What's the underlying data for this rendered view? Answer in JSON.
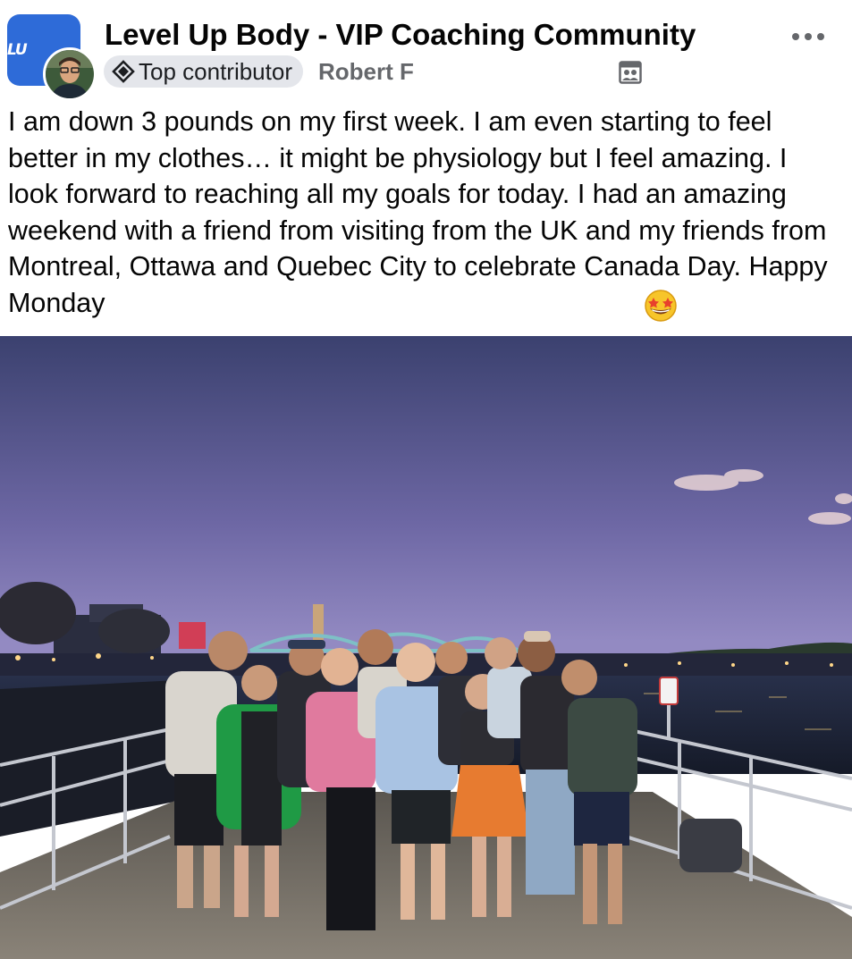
{
  "post": {
    "group_name": "Level Up Body - VIP Coaching Community",
    "group_logo_text": "LU",
    "badge_label": "Top contributor",
    "author_name": "Robert F",
    "more_icon": "more-horizontal-icon",
    "audience_icon": "group-members-icon",
    "text": "I am down 3 pounds on my first week. I am even starting to feel better in my clothes… it might be physiology but I feel amazing. I look forward to reaching all my goals for today. I had an amazing weekend with a friend from visiting from the UK and my friends from Montreal, Ottawa and Quebec City to celebrate Canada Day. Happy Monday",
    "emoji": "star-struck-emoji"
  },
  "colors": {
    "group_avatar": "#2e6bd8",
    "badge_bg": "#e4e6eb",
    "secondary_text": "#65676b",
    "sky_top": "#3e4472",
    "sky_horizon": "#8c82bc"
  }
}
